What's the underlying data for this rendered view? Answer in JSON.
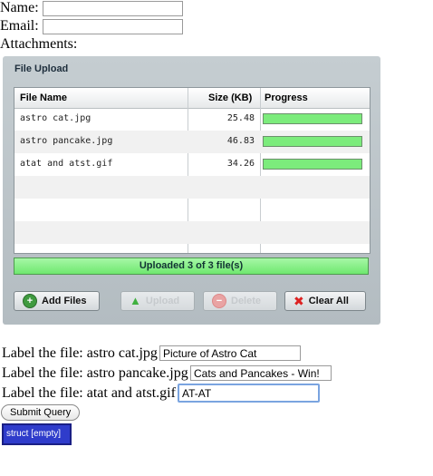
{
  "form": {
    "name_label": "Name:",
    "name_value": "",
    "email_label": "Email:",
    "email_value": "",
    "attachments_label": "Attachments:"
  },
  "uploader": {
    "title": "File Upload",
    "columns": [
      "File Name",
      "Size (KB)",
      "Progress"
    ],
    "files": [
      {
        "name": "astro cat.jpg",
        "size": "25.48",
        "progress": 1.0
      },
      {
        "name": "astro pancake.jpg",
        "size": "46.83",
        "progress": 1.0
      },
      {
        "name": "atat and atst.gif",
        "size": "34.26",
        "progress": 1.0
      }
    ],
    "status": "Uploaded 3 of 3 file(s)",
    "buttons": {
      "add": "Add Files",
      "upload": "Upload",
      "delete": "Delete",
      "clear": "Clear All"
    },
    "colors": {
      "progress_fill": "#7cec7c",
      "panel": "#bcc4c8"
    }
  },
  "labels": [
    {
      "prefix": "Label the file: astro cat.jpg",
      "value": "Picture of Astro Cat"
    },
    {
      "prefix": "Label the file: astro pancake.jpg",
      "value": "Cats and Pancakes - Win!"
    },
    {
      "prefix": "Label the file: atat and atst.gif",
      "value": "AT-AT"
    }
  ],
  "submit_label": "Submit Query",
  "struct_badge": "struct [empty]"
}
